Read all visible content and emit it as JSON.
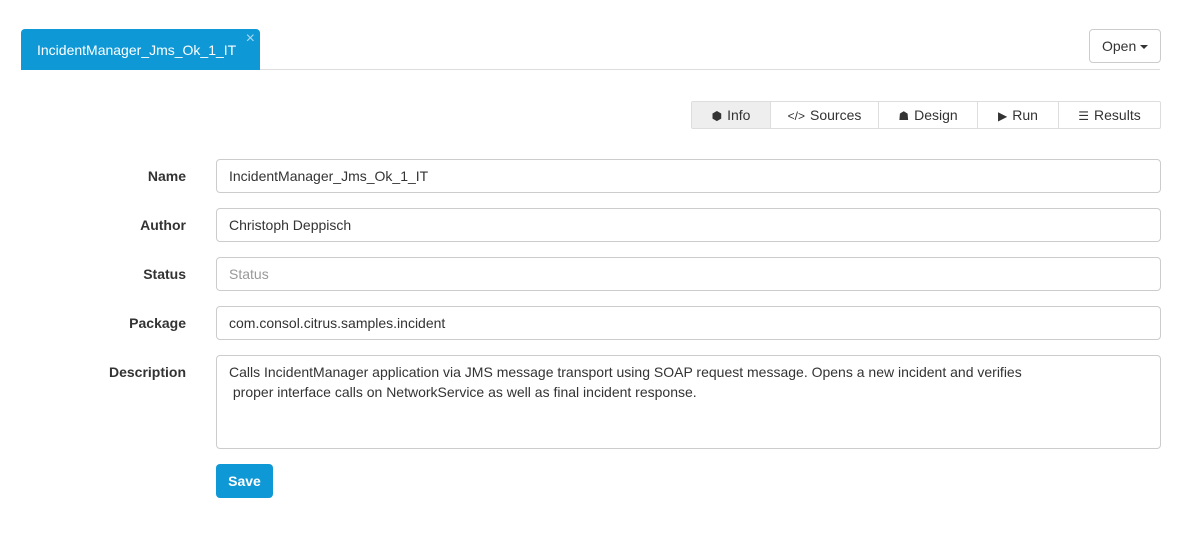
{
  "tab": {
    "title": "IncidentManager_Jms_Ok_1_IT",
    "close": "×"
  },
  "open_button": "Open",
  "view_tabs": [
    {
      "label": "Info",
      "icon": "cube-icon"
    },
    {
      "label": "Sources",
      "icon": "code-icon"
    },
    {
      "label": "Design",
      "icon": "sitemap-icon"
    },
    {
      "label": "Run",
      "icon": "play-circle-icon"
    },
    {
      "label": "Results",
      "icon": "list-icon"
    }
  ],
  "form": {
    "name": {
      "label": "Name",
      "value": "IncidentManager_Jms_Ok_1_IT"
    },
    "author": {
      "label": "Author",
      "value": "Christoph Deppisch"
    },
    "status": {
      "label": "Status",
      "placeholder": "Status"
    },
    "package": {
      "label": "Package",
      "value": "com.consol.citrus.samples.incident"
    },
    "description": {
      "label": "Description",
      "value": "Calls IncidentManager application via JMS message transport using SOAP request message. Opens a new incident and verifies\n proper interface calls on NetworkService as well as final incident response."
    }
  },
  "save_label": "Save"
}
